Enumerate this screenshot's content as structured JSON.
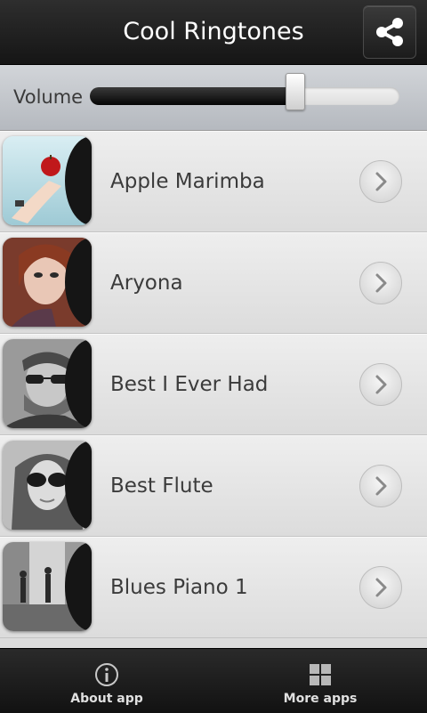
{
  "header": {
    "title": "Cool Ringtones",
    "share_icon": "share-icon"
  },
  "volume": {
    "label": "Volume",
    "level": 0.66
  },
  "ringtones": [
    {
      "name": "Apple Marimba",
      "art": "apple-hand"
    },
    {
      "name": "Aryona",
      "art": "woman-portrait"
    },
    {
      "name": "Best I Ever Had",
      "art": "man-sunglasses"
    },
    {
      "name": "Best Flute",
      "art": "girl-sunglasses"
    },
    {
      "name": "Blues Piano 1",
      "art": "street-scene"
    }
  ],
  "bottom_tabs": [
    {
      "label": "About app",
      "icon": "info-icon"
    },
    {
      "label": "More apps",
      "icon": "grid-icon"
    }
  ],
  "colors": {
    "header_bg": "#1e1e1e",
    "row_bg": "#e6e6e6",
    "text": "#3b3b3b"
  }
}
